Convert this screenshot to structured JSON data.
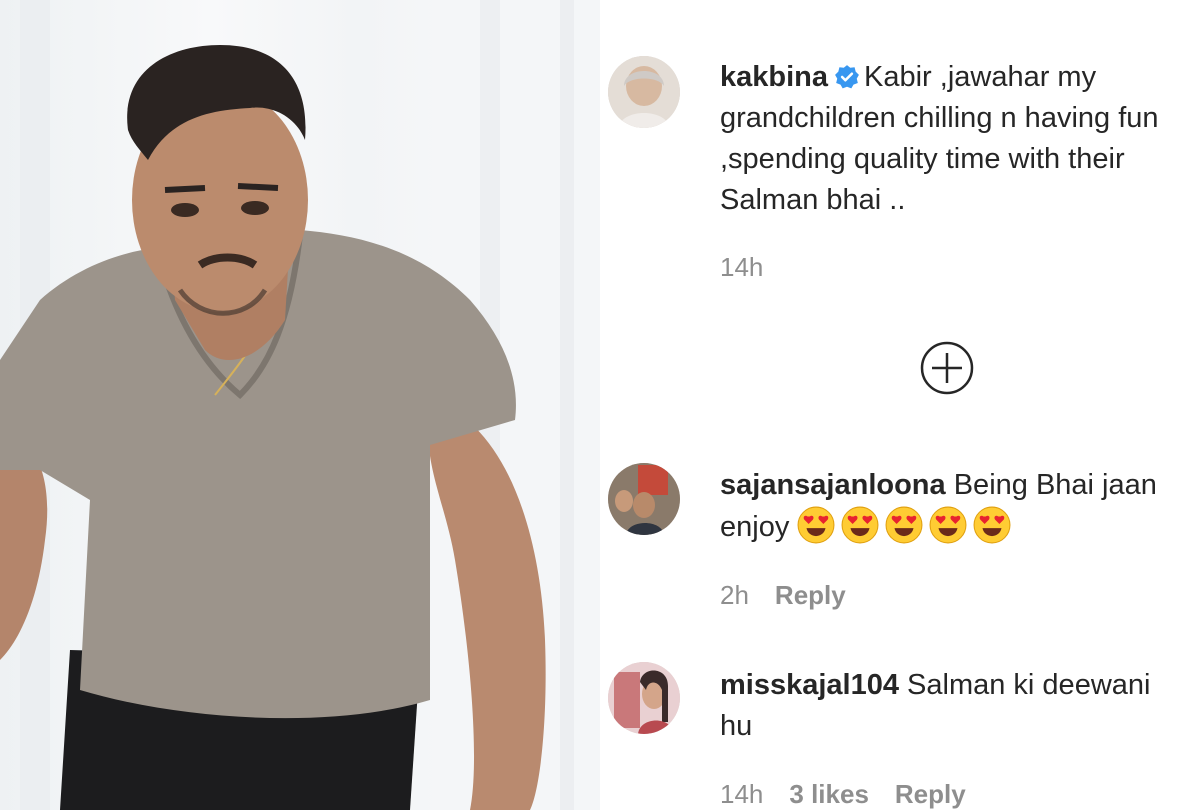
{
  "photo": {
    "icon": "person-photo"
  },
  "comments": [
    {
      "username": "kakbina",
      "verified": true,
      "lines": [
        "Kabir ,jawahar my",
        "grandchildren chilling n having fun",
        ",spending quality time with their",
        "Salman bhai .."
      ],
      "time": "14h"
    },
    {
      "username": "sajansajanloona",
      "lines": [
        "Being Bhai jaan",
        "enjoy"
      ],
      "emoji": "heart-eyes-emoji",
      "emoji_count": 5,
      "time": "2h",
      "reply": "Reply"
    },
    {
      "username": "misskajal104",
      "lines": [
        "Salman ki deewani",
        "hu"
      ],
      "time": "14h",
      "likes": "3 likes",
      "reply": "Reply"
    }
  ],
  "load_more": {
    "icon": "plus-circle-icon"
  },
  "colors": {
    "text": "#262626",
    "meta": "#8e8e8e",
    "verified": "#3897f0"
  }
}
